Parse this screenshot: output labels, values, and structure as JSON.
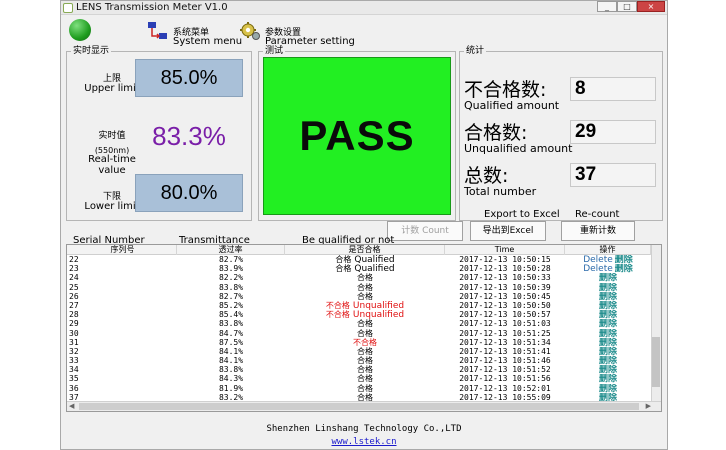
{
  "window": {
    "title": "LENS Transmission Meter V1.0",
    "controls": {
      "minimize": "_",
      "maximize": "□",
      "close": "×"
    }
  },
  "menu": {
    "system": {
      "zh": "系统菜单",
      "en": "System menu",
      "icon": "network-icon"
    },
    "parameter": {
      "zh": "参数设置",
      "en": "Parameter setting",
      "icon": "gear-icon"
    }
  },
  "realtime": {
    "group_label": "实时显示",
    "upper": {
      "zh": "上限",
      "en": "Upper limit",
      "value": "85.0%"
    },
    "current": {
      "zh": "实时值",
      "wavelength": "(550nm)",
      "en": "Real-time value",
      "value": "83.3%"
    },
    "lower": {
      "zh": "下限",
      "en": "Lower limit",
      "value": "80.0%"
    }
  },
  "test": {
    "group_label": "测试",
    "result": "PASS",
    "result_color": "#22ef22"
  },
  "stats": {
    "group_label": "统计",
    "fail": {
      "zh": "不合格数:",
      "en": "Qualified amount",
      "value": "8"
    },
    "pass": {
      "zh": "合格数:",
      "en": "Unqualified amount",
      "value": "29"
    },
    "total": {
      "zh": "总数:",
      "en": "Total number",
      "value": "37"
    }
  },
  "actions": {
    "count_label": "计数 Count",
    "export_caption": "Export to Excel",
    "export_label": "导出到Excel",
    "recount_caption": "Re-count",
    "recount_label": "重新计数"
  },
  "grid_captions": {
    "serial": "Serial Number",
    "trans": "Transmittance",
    "result": "Be qualified or not"
  },
  "table": {
    "headers": {
      "serial": "序列号",
      "trans": "透过率",
      "result": "是否合格",
      "time": "Time",
      "op": "操作"
    },
    "rows": [
      {
        "serial": "22",
        "trans": "82.7%",
        "result": "合格",
        "result_en": "Qualified",
        "time": "2017-12-13 10:50:15",
        "op_en": "Delete",
        "op": "删除"
      },
      {
        "serial": "23",
        "trans": "83.9%",
        "result": "合格",
        "result_en": "Qualified",
        "time": "2017-12-13 10:50:28",
        "op_en": "Delete",
        "op": "删除"
      },
      {
        "serial": "24",
        "trans": "82.2%",
        "result": "合格",
        "result_en": "",
        "time": "2017-12-13 10:50:33",
        "op_en": "",
        "op": "删除"
      },
      {
        "serial": "25",
        "trans": "83.8%",
        "result": "合格",
        "result_en": "",
        "time": "2017-12-13 10:50:39",
        "op_en": "",
        "op": "删除"
      },
      {
        "serial": "26",
        "trans": "82.7%",
        "result": "合格",
        "result_en": "",
        "time": "2017-12-13 10:50:45",
        "op_en": "",
        "op": "删除"
      },
      {
        "serial": "27",
        "trans": "85.2%",
        "result": "不合格",
        "result_en": "Unqualified",
        "time": "2017-12-13 10:50:50",
        "op_en": "",
        "op": "删除",
        "fail": true
      },
      {
        "serial": "28",
        "trans": "85.4%",
        "result": "不合格",
        "result_en": "Unqualified",
        "time": "2017-12-13 10:50:57",
        "op_en": "",
        "op": "删除",
        "fail": true
      },
      {
        "serial": "29",
        "trans": "83.8%",
        "result": "合格",
        "result_en": "",
        "time": "2017-12-13 10:51:03",
        "op_en": "",
        "op": "删除"
      },
      {
        "serial": "30",
        "trans": "84.7%",
        "result": "合格",
        "result_en": "",
        "time": "2017-12-13 10:51:25",
        "op_en": "",
        "op": "删除"
      },
      {
        "serial": "31",
        "trans": "87.5%",
        "result": "不合格",
        "result_en": "",
        "time": "2017-12-13 10:51:34",
        "op_en": "",
        "op": "删除",
        "fail": true
      },
      {
        "serial": "32",
        "trans": "84.1%",
        "result": "合格",
        "result_en": "",
        "time": "2017-12-13 10:51:41",
        "op_en": "",
        "op": "删除"
      },
      {
        "serial": "33",
        "trans": "84.1%",
        "result": "合格",
        "result_en": "",
        "time": "2017-12-13 10:51:46",
        "op_en": "",
        "op": "删除"
      },
      {
        "serial": "34",
        "trans": "83.8%",
        "result": "合格",
        "result_en": "",
        "time": "2017-12-13 10:51:52",
        "op_en": "",
        "op": "删除"
      },
      {
        "serial": "35",
        "trans": "84.3%",
        "result": "合格",
        "result_en": "",
        "time": "2017-12-13 10:51:56",
        "op_en": "",
        "op": "删除"
      },
      {
        "serial": "36",
        "trans": "81.9%",
        "result": "合格",
        "result_en": "",
        "time": "2017-12-13 10:52:01",
        "op_en": "",
        "op": "删除"
      },
      {
        "serial": "37",
        "trans": "83.2%",
        "result": "合格",
        "result_en": "",
        "time": "2017-12-13 10:55:09",
        "op_en": "",
        "op": "删除"
      }
    ]
  },
  "footer": {
    "company": "Shenzhen Linshang Technology Co.,LTD",
    "url": "www.lstek.cn"
  }
}
